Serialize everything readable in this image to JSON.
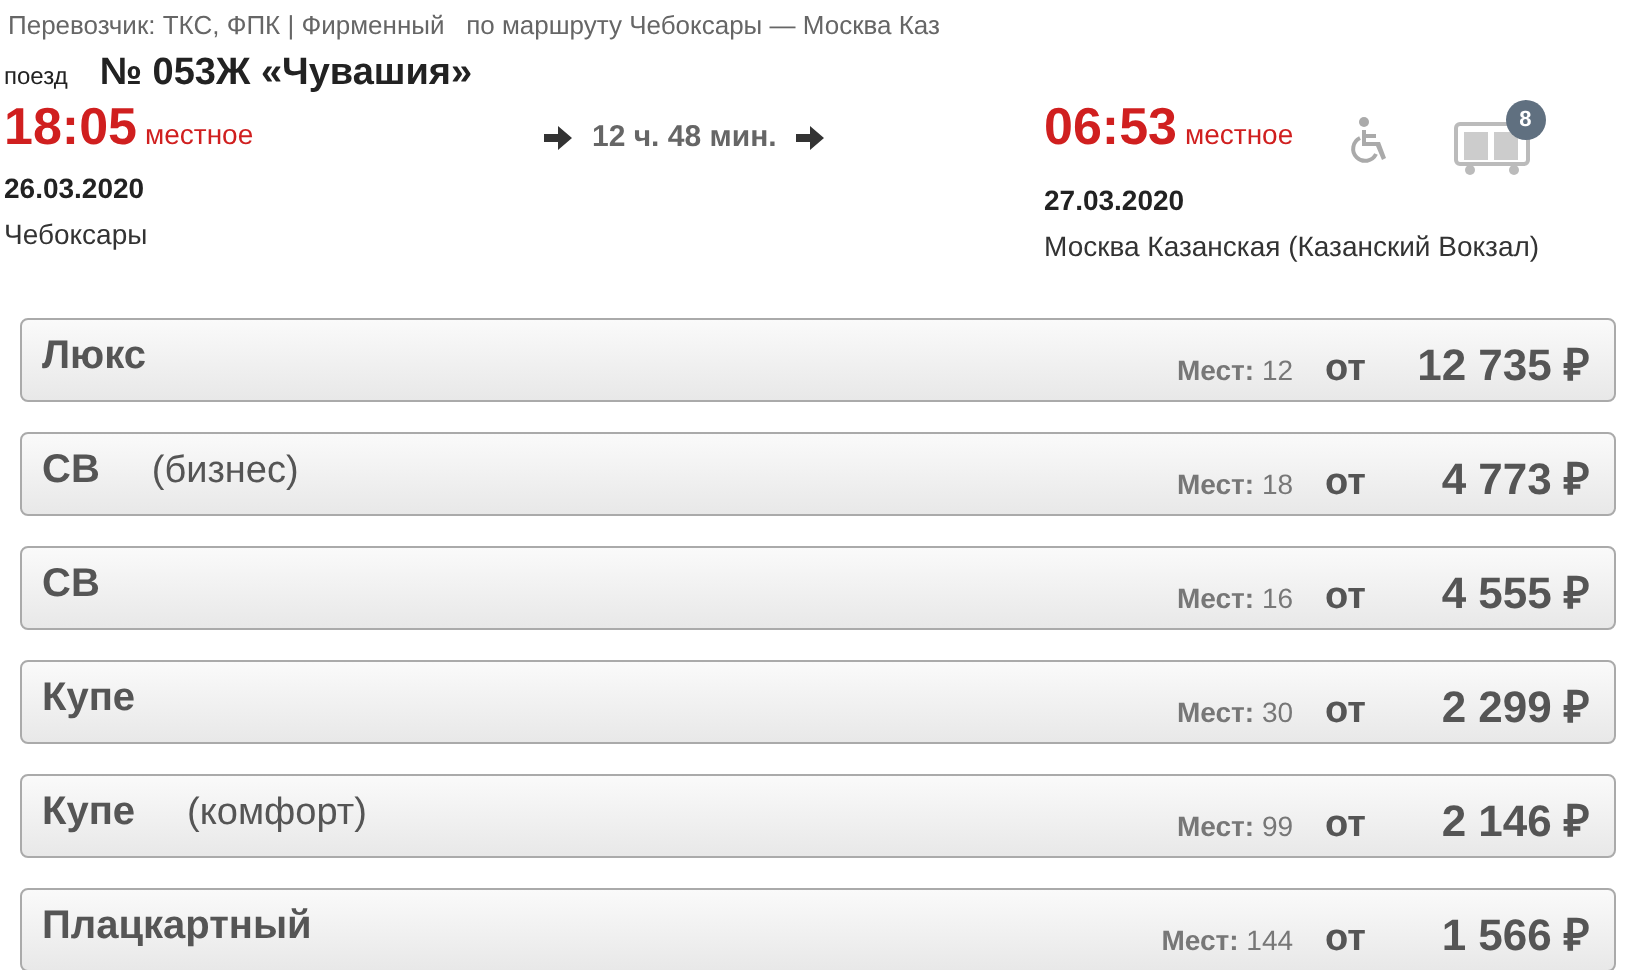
{
  "carrier_line": "Перевозчик: ТКС, ФПК | Фирменный   по маршруту Чебоксары — Москва Каз",
  "train": {
    "prefix": "поезд",
    "name": "№ 053Ж «Чувашия»"
  },
  "departure": {
    "time": "18:05",
    "time_note": "местное",
    "date": "26.03.2020",
    "station": "Чебоксары"
  },
  "duration": "12 ч. 48 мин.",
  "arrival": {
    "time": "06:53",
    "time_note": "местное",
    "date": "27.03.2020",
    "station": "Москва Казанская (Казанский Вокзал)"
  },
  "wheelchair_accessible": true,
  "cars_count": "8",
  "classes": [
    {
      "name": "Люкс",
      "seats": "**Мест:** 12",
      "from": "от",
      "price": "12 735 ₽"
    },
    {
      "name": "СВ",
      "subtitle": "(бизнес)",
      "seats": "**Мест:** 18",
      "from": "от",
      "price": "4 773 ₽"
    },
    {
      "name": "СВ",
      "seats": "**Мест:** 16",
      "from": "от",
      "price": "4 555 ₽"
    },
    {
      "name": "Купе",
      "seats": "**Мест:** 30",
      "from": "от",
      "price": "2 299 ₽"
    },
    {
      "name": "Купе",
      "subtitle": "(комфорт)",
      "seats": "**Мест:** 99",
      "from": "от",
      "price": "2 146 ₽"
    },
    {
      "name": "Плацкартный",
      "seats": "**Мест:** 144",
      "from": "от",
      "price": "1 566 ₽"
    }
  ]
}
